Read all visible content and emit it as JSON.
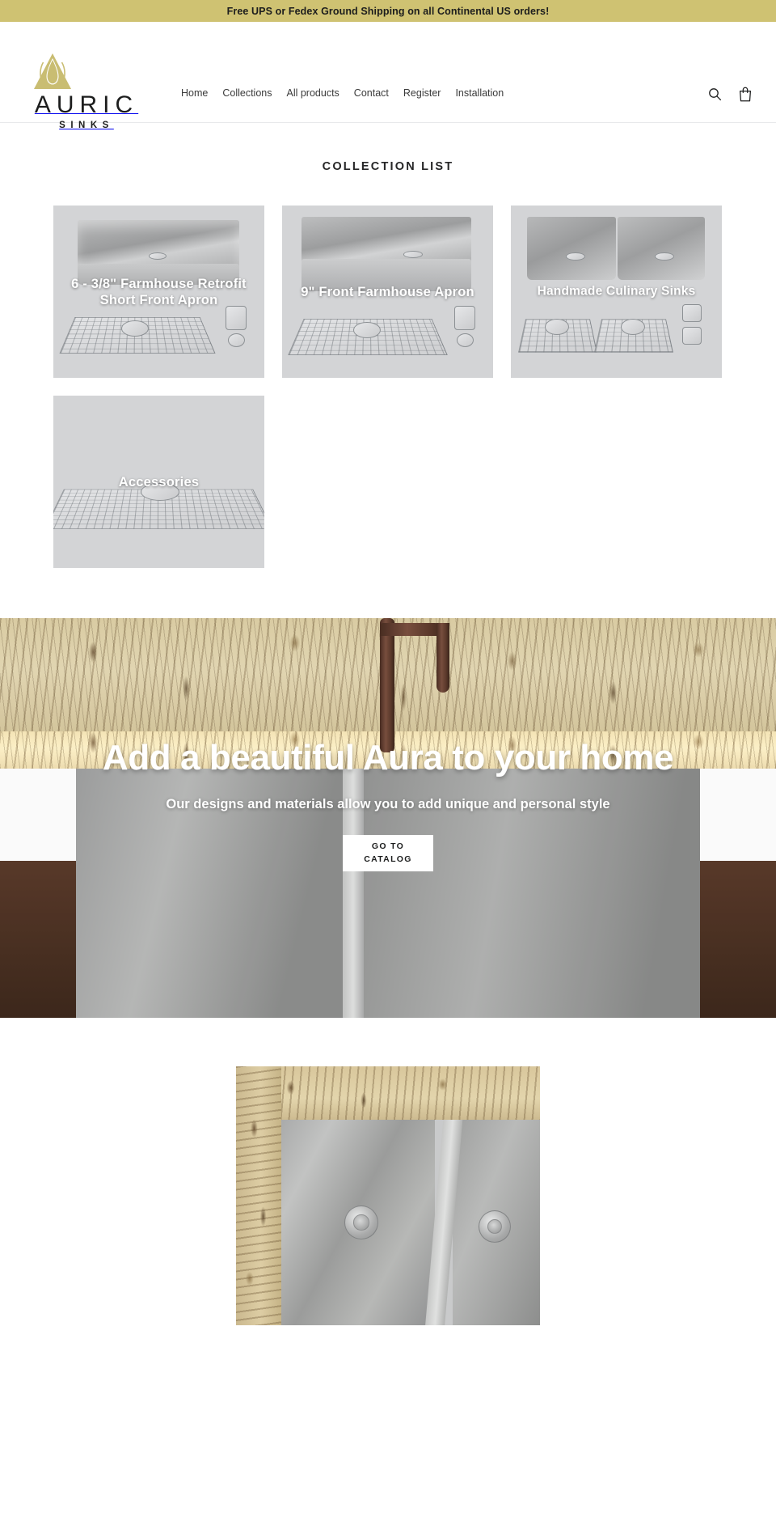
{
  "announcement": {
    "text": "Free UPS or Fedex Ground Shipping on all Continental US orders!",
    "background": "#cfc272"
  },
  "header": {
    "logo": {
      "word": "AURIC",
      "sub": "SINKS",
      "mark_icon": "auric-droplet-logo-icon",
      "mark_color": "#c9bd72"
    },
    "nav": [
      {
        "label": "Home"
      },
      {
        "label": "Collections"
      },
      {
        "label": "All products"
      },
      {
        "label": "Contact"
      },
      {
        "label": "Register"
      },
      {
        "label": "Installation"
      }
    ],
    "icons": [
      {
        "name": "search-icon",
        "label": "Search"
      },
      {
        "name": "cart-icon",
        "label": "Cart"
      }
    ]
  },
  "collections": {
    "title": "COLLECTION LIST",
    "cards": [
      {
        "title": "6 - 3/8\" Farmhouse Retrofit Short Front Apron",
        "image": "farmhouse-retrofit-short-front-apron-sink"
      },
      {
        "title": "9\" Front Farmhouse Apron",
        "image": "nine-inch-front-farmhouse-apron-sink"
      },
      {
        "title": "Handmade Culinary Sinks",
        "image": "handmade-culinary-double-bowl-sink"
      },
      {
        "title": "Accessories",
        "image": "sink-grid-rack-accessory"
      }
    ]
  },
  "hero": {
    "title": "Add a beautiful Aura to your home",
    "subtitle": "Our designs and materials allow you to add unique and personal style",
    "button_label": "GO TO CATALOG",
    "image": "granite-countertop-stainless-farmhouse-sink"
  },
  "bottom": {
    "image": "double-bowl-stainless-sink-granite-countertop"
  }
}
